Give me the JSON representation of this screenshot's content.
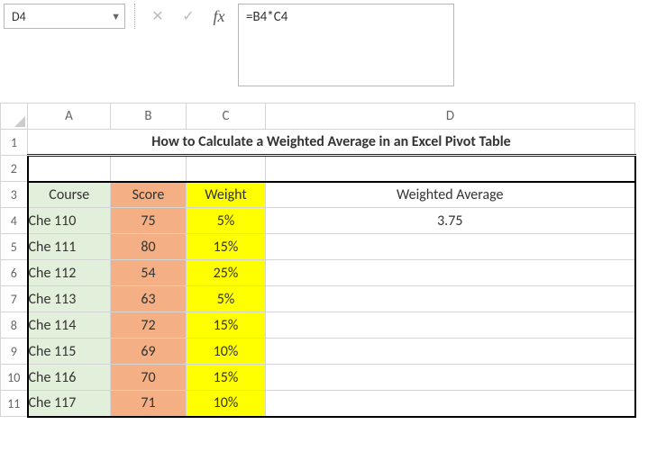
{
  "formula_bar": {
    "cell_ref": "D4",
    "formula": "=B4*C4",
    "cancel": "✕",
    "confirm": "✓",
    "fx": "fx"
  },
  "columns": {
    "A": "A",
    "B": "B",
    "C": "C",
    "D": "D"
  },
  "rows": [
    "1",
    "2",
    "3",
    "4",
    "5",
    "6",
    "7",
    "8",
    "9",
    "10",
    "11"
  ],
  "title": "How to Calculate a Weighted Average in an Excel Pivot Table",
  "headers": {
    "course": "Course",
    "score": "Score",
    "weight": "Weight",
    "wavg": "Weighted Average"
  },
  "data": [
    {
      "course": "Che 110",
      "score": "75",
      "weight": "5%",
      "wavg": "3.75"
    },
    {
      "course": "Che 111",
      "score": "80",
      "weight": "15%",
      "wavg": ""
    },
    {
      "course": "Che 112",
      "score": "54",
      "weight": "25%",
      "wavg": ""
    },
    {
      "course": "Che 113",
      "score": "63",
      "weight": "5%",
      "wavg": ""
    },
    {
      "course": "Che 114",
      "score": "72",
      "weight": "15%",
      "wavg": ""
    },
    {
      "course": "Che 115",
      "score": "69",
      "weight": "10%",
      "wavg": ""
    },
    {
      "course": "Che 116",
      "score": "70",
      "weight": "15%",
      "wavg": ""
    },
    {
      "course": "Che 117",
      "score": "71",
      "weight": "10%",
      "wavg": ""
    }
  ]
}
